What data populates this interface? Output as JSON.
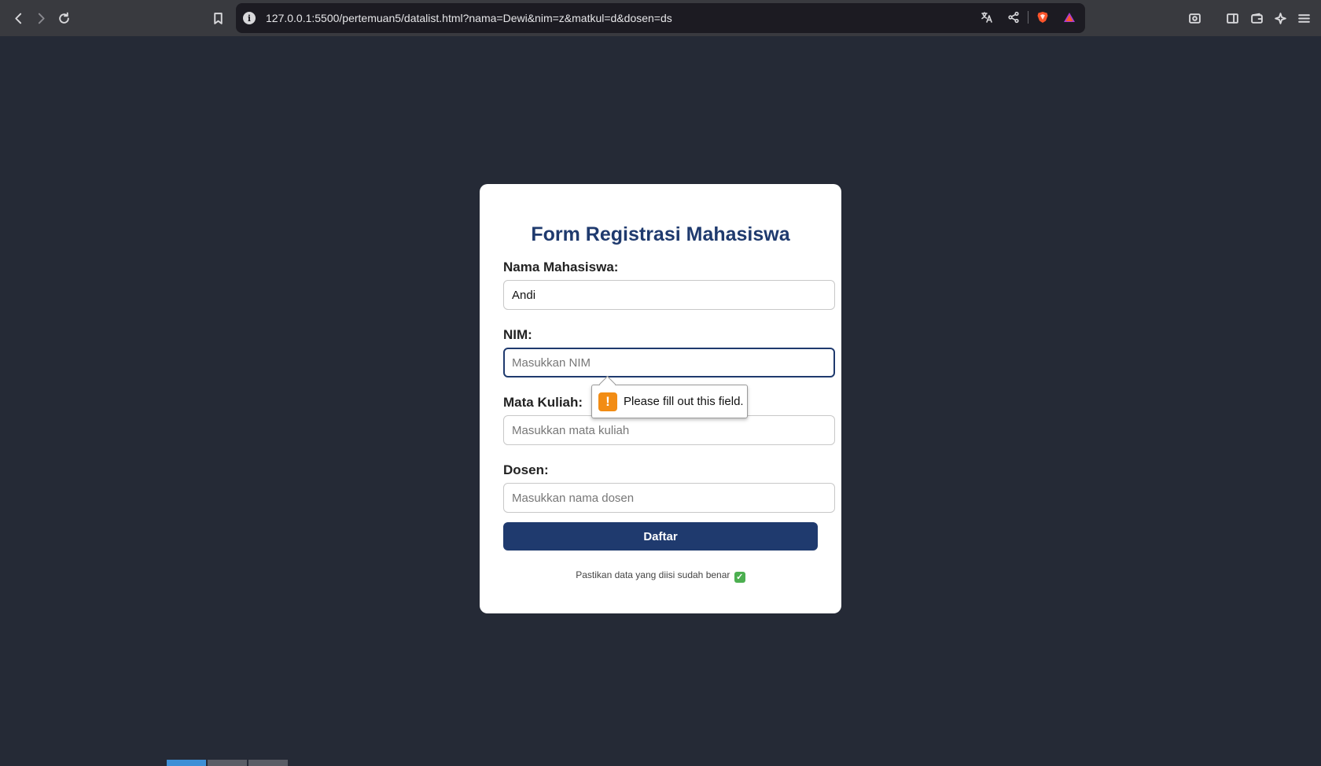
{
  "browser": {
    "url": "127.0.0.1:5500/pertemuan5/datalist.html?nama=Dewi&nim=z&matkul=d&dosen=ds",
    "site_info_glyph": "i",
    "icons": [
      "back-icon",
      "forward-icon",
      "reload-icon",
      "bookmark-icon",
      "translate-icon",
      "share-icon",
      "brave-shield-icon",
      "brave-rewards-icon",
      "screenshot-icon",
      "sidebar-icon",
      "wallet-icon",
      "leo-ai-icon",
      "menu-icon"
    ]
  },
  "form": {
    "title": "Form Registrasi Mahasiswa",
    "fields": [
      {
        "label": "Nama Mahasiswa:",
        "value": "Andi",
        "placeholder": ""
      },
      {
        "label": "NIM:",
        "value": "",
        "placeholder": "Masukkan NIM"
      },
      {
        "label": "Mata Kuliah:",
        "value": "",
        "placeholder": "Masukkan mata kuliah"
      },
      {
        "label": "Dosen:",
        "value": "",
        "placeholder": "Masukkan nama dosen"
      }
    ],
    "submit_label": "Daftar",
    "note": "Pastikan data yang diisi sudah benar",
    "note_emoji": "✓"
  },
  "validation": {
    "glyph": "!",
    "message": "Please fill out this field."
  },
  "colors": {
    "background": "#252a36",
    "primary": "#1f3a6e",
    "toolbar": "#393a3f",
    "warning": "#f28c14"
  }
}
